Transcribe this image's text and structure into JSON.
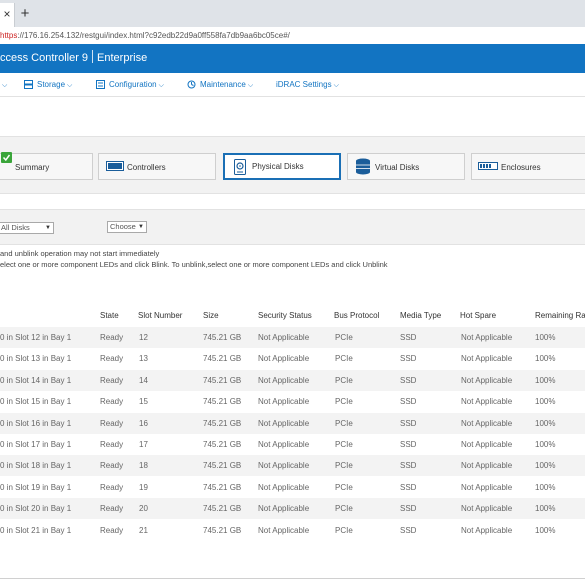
{
  "browser": {
    "tab_close": "×",
    "new_tab": "+",
    "url_scheme": "https",
    "url_rest": "://176.16.254.132/restgui/index.html?c92edb22d9a0ff558fa7db9aa6bc05ce#/"
  },
  "header": {
    "title_left": "ccess Controller 9",
    "title_right": "Enterprise",
    "bg_color": "#1274c2"
  },
  "nav": {
    "items": [
      {
        "label": "",
        "chevron": "⌵"
      },
      {
        "label": "Storage",
        "chevron": "⌵",
        "icon": "storage-icon"
      },
      {
        "label": "Configuration",
        "chevron": "⌵",
        "icon": "configuration-icon"
      },
      {
        "label": "Maintenance",
        "chevron": "⌵",
        "icon": "maintenance-icon"
      },
      {
        "label": "iDRAC Settings",
        "chevron": "⌵"
      }
    ]
  },
  "component_tabs": [
    {
      "label": "Summary",
      "icon": "summary-check-icon"
    },
    {
      "label": "Controllers",
      "icon": "controller-icon"
    },
    {
      "label": "Physical Disks",
      "icon": "physical-disk-icon",
      "active": true
    },
    {
      "label": "Virtual Disks",
      "icon": "virtual-disk-icon"
    },
    {
      "label": "Enclosures",
      "icon": "enclosure-icon"
    }
  ],
  "filters": {
    "disks_select": "All Disks",
    "action_select": "Choose"
  },
  "info": {
    "line1": "and unblink operation may not start immediately",
    "line2": "elect one or more component LEDs and click Blink. To unblink,select one or more component LEDs and click Unblink"
  },
  "table": {
    "columns": [
      "State",
      "Slot Number",
      "Size",
      "Security Status",
      "Bus Protocol",
      "Media Type",
      "Hot Spare",
      "Remaining Rat"
    ],
    "rows": [
      {
        "name": "0 in Slot 12 in Bay 1",
        "state": "Ready",
        "slot": "12",
        "size": "745.21 GB",
        "security": "Not Applicable",
        "bus": "PCIe",
        "media": "SSD",
        "hotspare": "Not Applicable",
        "remaining": "100%"
      },
      {
        "name": "0 in Slot 13 in Bay 1",
        "state": "Ready",
        "slot": "13",
        "size": "745.21 GB",
        "security": "Not Applicable",
        "bus": "PCIe",
        "media": "SSD",
        "hotspare": "Not Applicable",
        "remaining": "100%"
      },
      {
        "name": "0 in Slot 14 in Bay 1",
        "state": "Ready",
        "slot": "14",
        "size": "745.21 GB",
        "security": "Not Applicable",
        "bus": "PCIe",
        "media": "SSD",
        "hotspare": "Not Applicable",
        "remaining": "100%"
      },
      {
        "name": "0 in Slot 15 in Bay 1",
        "state": "Ready",
        "slot": "15",
        "size": "745.21 GB",
        "security": "Not Applicable",
        "bus": "PCIe",
        "media": "SSD",
        "hotspare": "Not Applicable",
        "remaining": "100%"
      },
      {
        "name": "0 in Slot 16 in Bay 1",
        "state": "Ready",
        "slot": "16",
        "size": "745.21 GB",
        "security": "Not Applicable",
        "bus": "PCIe",
        "media": "SSD",
        "hotspare": "Not Applicable",
        "remaining": "100%"
      },
      {
        "name": "0 in Slot 17 in Bay 1",
        "state": "Ready",
        "slot": "17",
        "size": "745.21 GB",
        "security": "Not Applicable",
        "bus": "PCIe",
        "media": "SSD",
        "hotspare": "Not Applicable",
        "remaining": "100%"
      },
      {
        "name": "0 in Slot 18 in Bay 1",
        "state": "Ready",
        "slot": "18",
        "size": "745.21 GB",
        "security": "Not Applicable",
        "bus": "PCIe",
        "media": "SSD",
        "hotspare": "Not Applicable",
        "remaining": "100%"
      },
      {
        "name": "0 in Slot 19 in Bay 1",
        "state": "Ready",
        "slot": "19",
        "size": "745.21 GB",
        "security": "Not Applicable",
        "bus": "PCIe",
        "media": "SSD",
        "hotspare": "Not Applicable",
        "remaining": "100%"
      },
      {
        "name": "0 in Slot 20 in Bay 1",
        "state": "Ready",
        "slot": "20",
        "size": "745.21 GB",
        "security": "Not Applicable",
        "bus": "PCIe",
        "media": "SSD",
        "hotspare": "Not Applicable",
        "remaining": "100%"
      },
      {
        "name": "0 in Slot 21 in Bay 1",
        "state": "Ready",
        "slot": "21",
        "size": "745.21 GB",
        "security": "Not Applicable",
        "bus": "PCIe",
        "media": "SSD",
        "hotspare": "Not Applicable",
        "remaining": "100%"
      }
    ]
  }
}
